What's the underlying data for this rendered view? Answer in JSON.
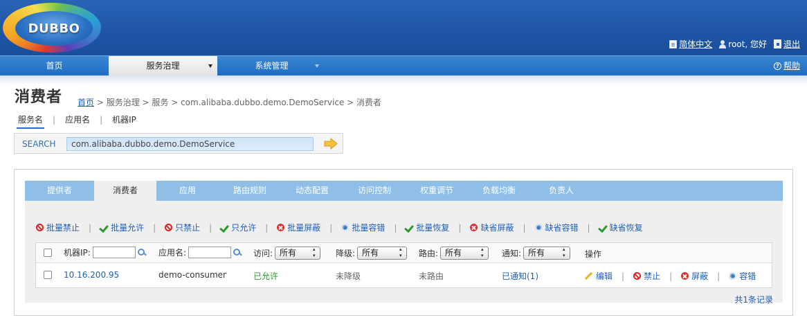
{
  "header": {
    "logo_text": "DUBBO",
    "language": "简体中文",
    "greeting": "root, 您好",
    "logout": "退出"
  },
  "nav": {
    "items": [
      {
        "label": "首页"
      },
      {
        "label": "服务治理"
      },
      {
        "label": "系统管理"
      }
    ],
    "help": "帮助"
  },
  "page": {
    "title": "消费者",
    "breadcrumb": {
      "home": "首页",
      "rest": "> 服务治理 > 服务 > com.alibaba.dubbo.demo.DemoService > 消费者"
    }
  },
  "search": {
    "tabs": [
      "服务名",
      "应用名",
      "机器IP"
    ],
    "label": "SEARCH",
    "value": "com.alibaba.dubbo.demo.DemoService"
  },
  "tabs": [
    "提供者",
    "消费者",
    "应用",
    "路由规则",
    "动态配置",
    "访问控制",
    "权重调节",
    "负载均衡",
    "负责人"
  ],
  "toolbar": [
    {
      "label": "批量禁止",
      "icon": "ban-icon"
    },
    {
      "label": "批量允许",
      "icon": "check-icon"
    },
    {
      "label": "只禁止",
      "icon": "ban-icon"
    },
    {
      "label": "只允许",
      "icon": "check-icon"
    },
    {
      "label": "批量屏蔽",
      "icon": "x-circle-icon"
    },
    {
      "label": "批量容错",
      "icon": "gear-icon"
    },
    {
      "label": "批量恢复",
      "icon": "check-icon"
    },
    {
      "label": "缺省屏蔽",
      "icon": "x-circle-icon"
    },
    {
      "label": "缺省容错",
      "icon": "gear-icon"
    },
    {
      "label": "缺省恢复",
      "icon": "check-icon"
    }
  ],
  "table": {
    "headers": {
      "ip": "机器IP:",
      "app": "应用名:",
      "access": "访问:",
      "degrade": "降级:",
      "route": "路由:",
      "notify": "通知:",
      "ops": "操作"
    },
    "filters": {
      "access": "所有",
      "degrade": "所有",
      "route": "所有",
      "notify": "所有"
    },
    "rows": [
      {
        "ip": "10.16.200.95",
        "app": "demo-consumer",
        "access": "已允许",
        "degrade": "未降级",
        "route": "未路由",
        "notify": "已通知(1)",
        "ops": [
          "编辑",
          "禁止",
          "屏蔽",
          "容错"
        ]
      }
    ]
  },
  "record_count": "共1条记录",
  "colors": {
    "header_blue": "#1f56a8",
    "nav_blue": "#2a75c8",
    "tab_bar": "#8fbfe6",
    "link": "#1f5fb5",
    "allowed_green": "#2a9a2a"
  }
}
